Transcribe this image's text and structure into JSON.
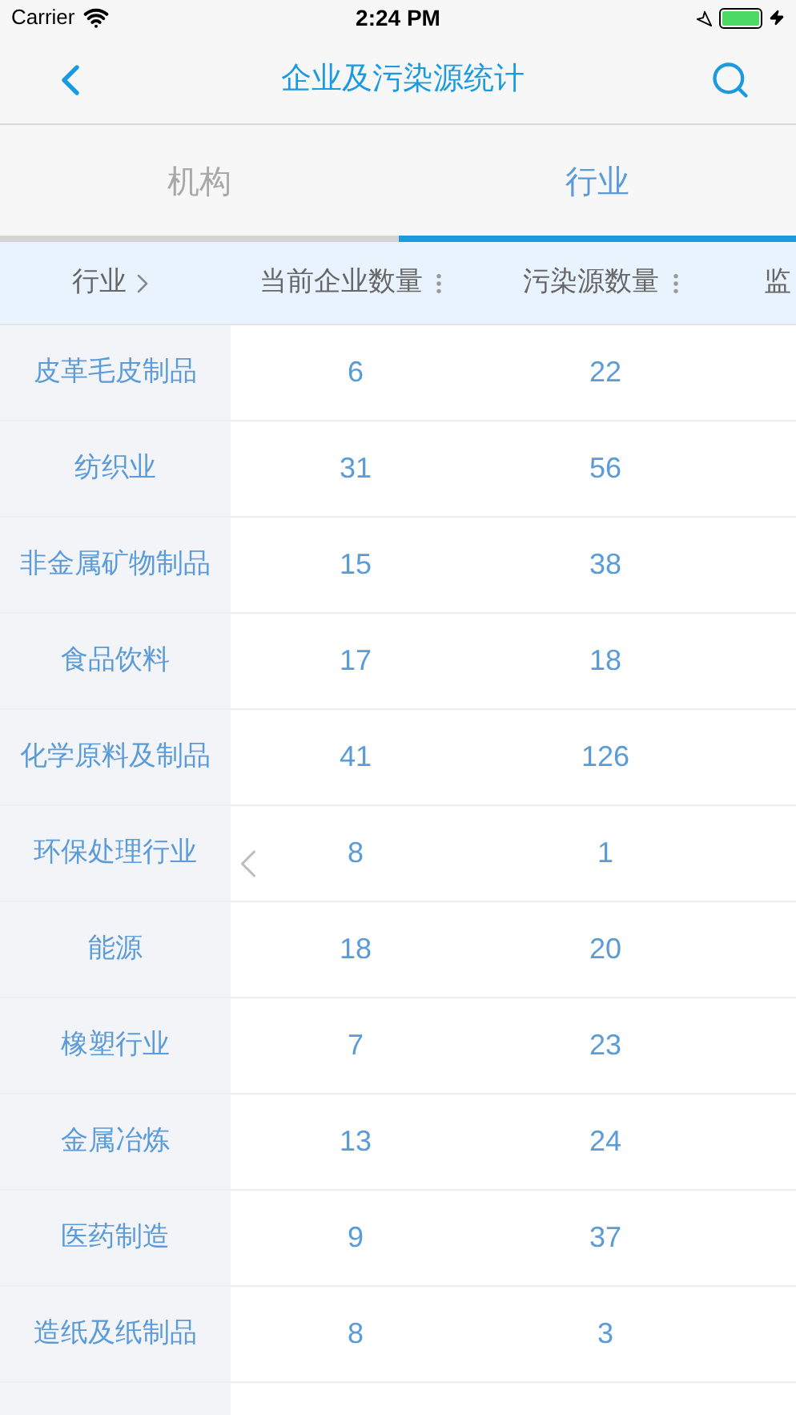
{
  "status_bar": {
    "carrier": "Carrier",
    "time": "2:24 PM"
  },
  "nav": {
    "title": "企业及污染源统计"
  },
  "tabs": [
    {
      "label": "机构",
      "selected": false
    },
    {
      "label": "行业",
      "selected": true
    }
  ],
  "table": {
    "columns": [
      {
        "label": "行业",
        "kind": "drill"
      },
      {
        "label": "当前企业数量",
        "kind": "sort"
      },
      {
        "label": "污染源数量",
        "kind": "sort"
      },
      {
        "label": "监",
        "kind": "plain"
      }
    ],
    "rows": [
      {
        "name": "皮革毛皮制品",
        "values": [
          "6",
          "22"
        ]
      },
      {
        "name": "纺织业",
        "values": [
          "31",
          "56"
        ]
      },
      {
        "name": "非金属矿物制品",
        "values": [
          "15",
          "38"
        ]
      },
      {
        "name": "食品饮料",
        "values": [
          "17",
          "18"
        ]
      },
      {
        "name": "化学原料及制品",
        "values": [
          "41",
          "126"
        ]
      },
      {
        "name": "环保处理行业",
        "values": [
          "8",
          "1"
        ]
      },
      {
        "name": "能源",
        "values": [
          "18",
          "20"
        ]
      },
      {
        "name": "橡塑行业",
        "values": [
          "7",
          "23"
        ]
      },
      {
        "name": "金属冶炼",
        "values": [
          "13",
          "24"
        ]
      },
      {
        "name": "医药制造",
        "values": [
          "9",
          "37"
        ]
      },
      {
        "name": "造纸及纸制品",
        "values": [
          "8",
          "3"
        ]
      }
    ]
  }
}
